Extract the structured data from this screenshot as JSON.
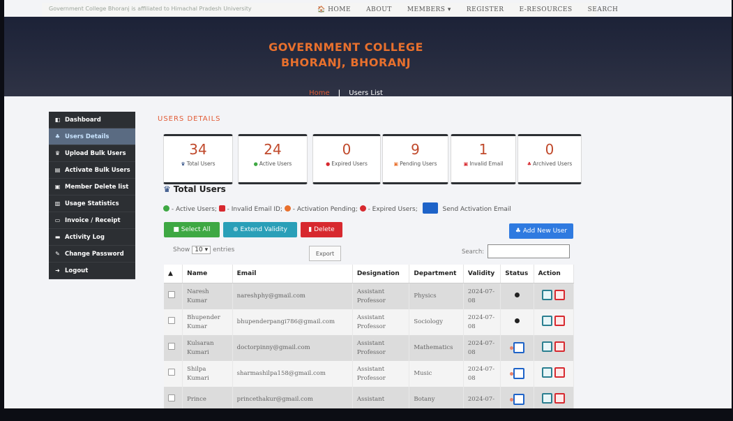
{
  "topnav": {
    "tagline": "Government College Bhoranj is affiliated to Himachal Pradesh University",
    "links": [
      "🏠 HOME",
      "ABOUT",
      "MEMBERS ▾",
      "REGISTER",
      "E-RESOURCES",
      "SEARCH"
    ]
  },
  "hero": {
    "title_line1": "GOVERNMENT COLLEGE",
    "title_line2": "BHORANJ, BHORANJ",
    "crumb_home": "Home",
    "crumb_sep": "|",
    "crumb_current": "Users List"
  },
  "sidebar": {
    "items": [
      {
        "label": "Dashboard",
        "icon": "dashboard-icon",
        "glyph": "◧"
      },
      {
        "label": "Users Details",
        "icon": "users-icon",
        "glyph": "♣"
      },
      {
        "label": "Upload Bulk Users",
        "icon": "users-upload-icon",
        "glyph": "♛"
      },
      {
        "label": "Activate Bulk Users",
        "icon": "activate-icon",
        "glyph": "▤"
      },
      {
        "label": "Member Delete list",
        "icon": "trash-icon",
        "glyph": "▣"
      },
      {
        "label": "Usage Statistics",
        "icon": "chart-icon",
        "glyph": "▥"
      },
      {
        "label": "Invoice / Receipt",
        "icon": "print-icon",
        "glyph": "▭"
      },
      {
        "label": "Activity Log",
        "icon": "log-icon",
        "glyph": "▬"
      },
      {
        "label": "Change Password",
        "icon": "key-icon",
        "glyph": "✎"
      },
      {
        "label": "Logout",
        "icon": "logout-icon",
        "glyph": "➜"
      }
    ]
  },
  "section_title": "USERS DETAILS",
  "stats": [
    {
      "value": "34",
      "label": "Total Users",
      "icon": "users-icon",
      "glyph": "♛",
      "color": "#1d3f7a"
    },
    {
      "value": "24",
      "label": "Active Users",
      "icon": "check-circle-icon",
      "glyph": "●",
      "color": "#3ea843"
    },
    {
      "value": "0",
      "label": "Expired Users",
      "icon": "minus-circle-icon",
      "glyph": "●",
      "color": "#d7292f"
    },
    {
      "value": "9",
      "label": "Pending Users",
      "icon": "pending-icon",
      "glyph": "▣",
      "color": "#e8702d"
    },
    {
      "value": "1",
      "label": "Invalid Email",
      "icon": "invalid-email-icon",
      "glyph": "▣",
      "color": "#d7292f"
    },
    {
      "value": "0",
      "label": "Archived Users",
      "icon": "archive-icon",
      "glyph": "♣",
      "color": "#d7292f"
    }
  ],
  "total_heading": "Total Users",
  "legend": {
    "active": "- Active Users;",
    "invalid": "- Invalid Email ID;",
    "pending": "- Activation Pending;",
    "expired": "- Expired Users;",
    "send": "Send Activation Email"
  },
  "buttons": {
    "select_all": "Select All",
    "extend_validity": "Extend Validity",
    "delete": "Delete",
    "add_new_user": "Add New User",
    "export": "Export"
  },
  "table_controls": {
    "show": "Show",
    "entries_value": "10 ▾",
    "entries": "entries",
    "search_label": "Search:"
  },
  "table": {
    "headers": [
      "▲",
      "Name",
      "Email",
      "Designation",
      "Department",
      "Validity",
      "Status",
      "Action"
    ],
    "rows": [
      {
        "name": "Naresh Kumar",
        "email": "nareshphy@gmail.com",
        "designation": "Assistant Professor",
        "department": "Physics",
        "validity": "2024-07-08",
        "status": "active"
      },
      {
        "name": "Bhupender Kumar",
        "email": "bhupenderpangi786@gmail.com",
        "designation": "Assistant Professor",
        "department": "Sociology",
        "validity": "2024-07-08",
        "status": "active"
      },
      {
        "name": "Kulsaran Kumari",
        "email": "doctorpinny@gmail.com",
        "designation": "Assistant Professor",
        "department": "Mathematics",
        "validity": "2024-07-08",
        "status": "pending"
      },
      {
        "name": "Shilpa Kumari",
        "email": "sharmashilpa158@gmail.com",
        "designation": "Assistant Professor",
        "department": "Music",
        "validity": "2024-07-08",
        "status": "pending"
      },
      {
        "name": "Prince",
        "email": "princethakur@gmail.com",
        "designation": "Assistant",
        "department": "Botany",
        "validity": "2024-07-",
        "status": "pending"
      }
    ]
  },
  "colors": {
    "accent": "#e8702d",
    "sidebar": "#2c2f33",
    "hero": "#1c2237"
  }
}
